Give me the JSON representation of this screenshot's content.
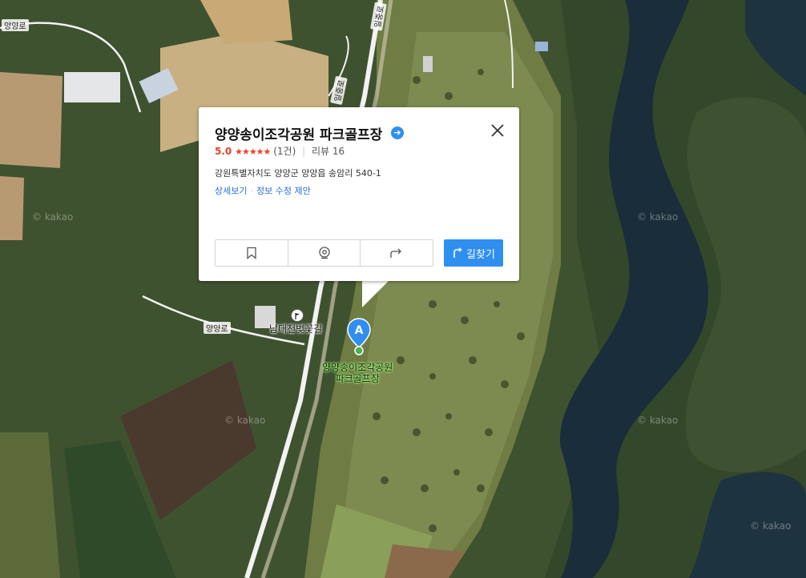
{
  "map": {
    "road_labels": [
      "양양로",
      "양양로",
      "일중로",
      "일중로"
    ],
    "poi_name": "남대천벚꽃길",
    "poi_icon": "flag-icon",
    "place_label_line1": "양양송이조각공원",
    "place_label_line2": "파크골프장",
    "marker_letter": "A",
    "watermark": "© kakao",
    "colors": {
      "river": "#1a2d3a",
      "marker": "#2f8ff0",
      "place_label_halo": "#9f6"
    }
  },
  "popup": {
    "title": "양양송이조각공원 파크골프장",
    "title_arrow_icon": "chevron-right-circle-icon",
    "rating": "5.0",
    "stars": "★★★★★",
    "rating_count": "(1건)",
    "review": "리뷰 16",
    "address": "강원특별자치도 양양군 양양읍 송암리 540-1",
    "link_detail": "상세보기",
    "link_edit": "정보 수정 제안",
    "actions": [
      {
        "name": "bookmark-icon"
      },
      {
        "name": "roadview-icon"
      },
      {
        "name": "share-icon"
      }
    ],
    "route_label": "길찾기",
    "route_icon": "route-icon",
    "close_icon": "close-icon",
    "colors": {
      "accent": "#2f8ff0",
      "rating": "#e8432b",
      "link": "#2a6fd6"
    }
  }
}
